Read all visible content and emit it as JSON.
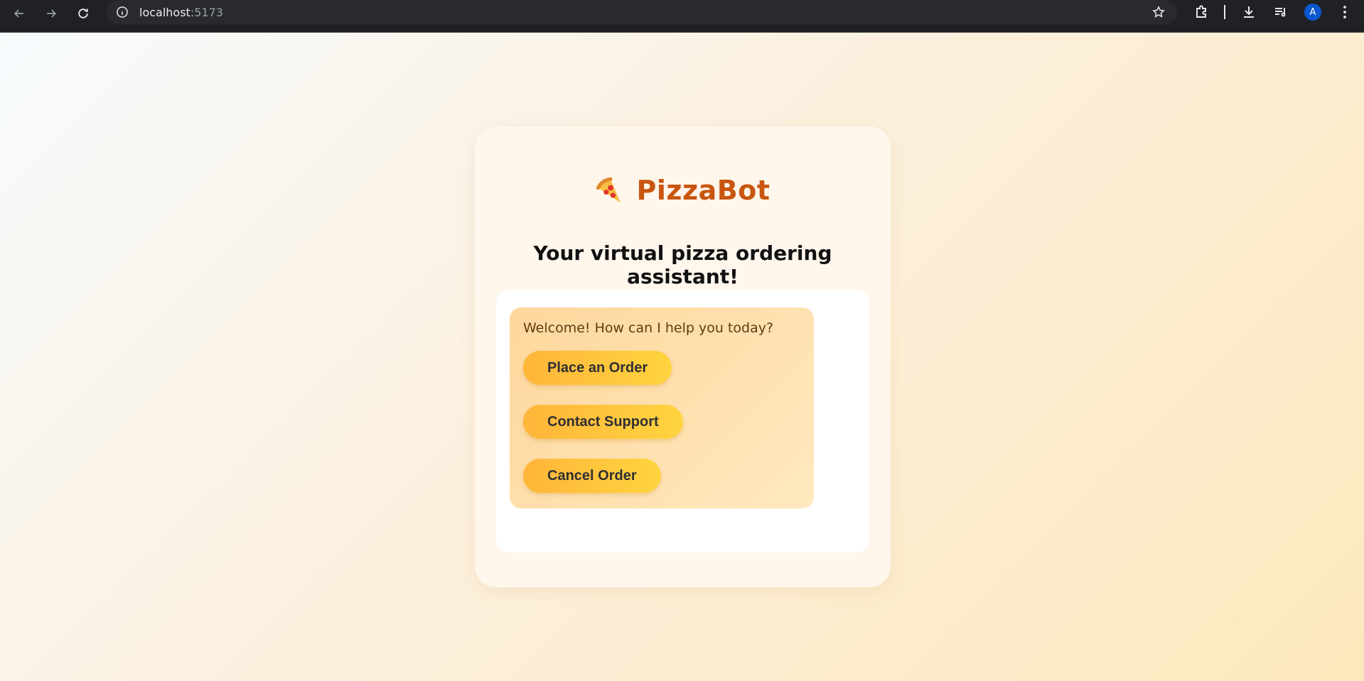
{
  "browser": {
    "url_host": "localhost",
    "url_port": ":5173",
    "profile_initial": "A"
  },
  "app": {
    "name": "PizzaBot",
    "tagline": "Your virtual pizza ordering assistant!",
    "logo_icon": "pizza-slice-icon",
    "accent_color": "#c9560f"
  },
  "chat": {
    "welcome_message": "Welcome! How can I help you today?",
    "options": [
      {
        "label": "Place an Order"
      },
      {
        "label": "Contact Support"
      },
      {
        "label": "Cancel Order"
      }
    ]
  }
}
